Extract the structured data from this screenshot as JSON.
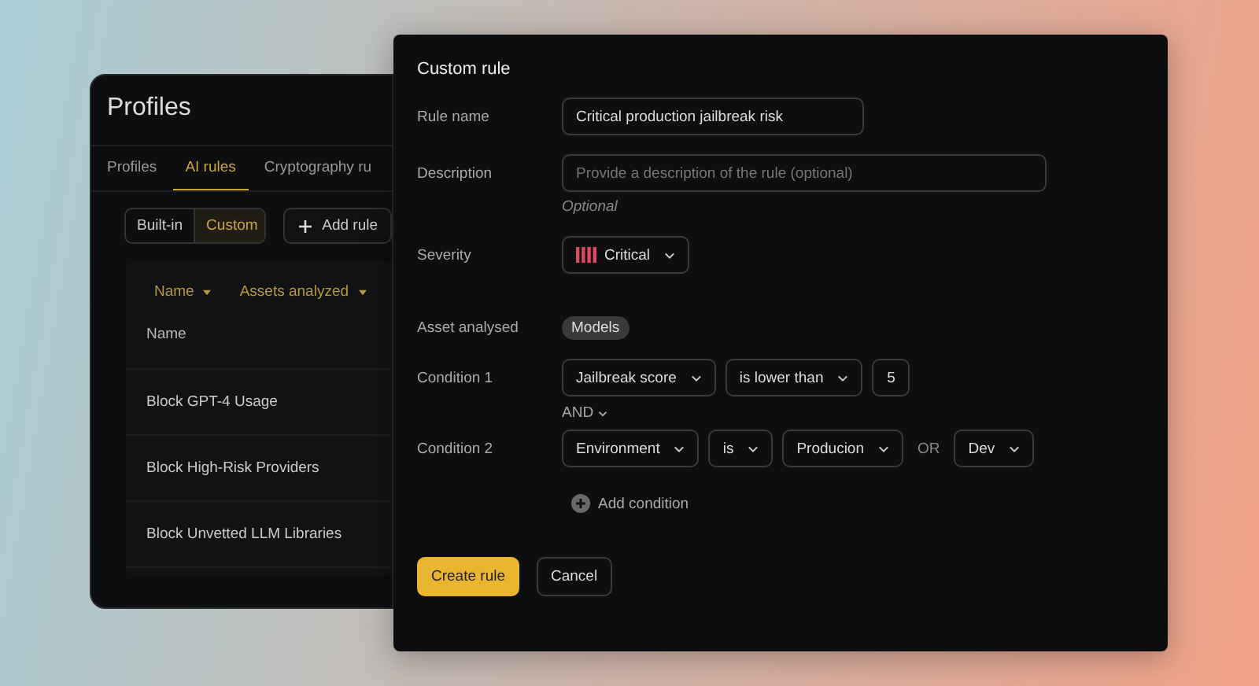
{
  "back_window": {
    "title": "Profiles",
    "tabs": [
      {
        "label": "Profiles",
        "selected": false
      },
      {
        "label": "AI rules",
        "selected": true
      },
      {
        "label": "Cryptography ru",
        "selected": false
      }
    ],
    "segments": [
      {
        "label": "Built-in",
        "selected": false
      },
      {
        "label": "Custom",
        "selected": true
      }
    ],
    "add_button": "Add rule",
    "sort_columns": [
      "Name",
      "Assets analyzed"
    ],
    "table": {
      "column": "Name",
      "rows": [
        "Block GPT-4 Usage",
        "Block High-Risk Providers",
        "Block Unvetted LLM Libraries"
      ]
    }
  },
  "dialog": {
    "title": "Custom rule",
    "rule_name": {
      "label": "Rule name",
      "value": "Critical production jailbreak risk"
    },
    "description": {
      "label": "Description",
      "placeholder": "Provide a description of the rule (optional)",
      "hint": "Optional"
    },
    "severity": {
      "label": "Severity",
      "value": "Critical",
      "color": "#e0485f"
    },
    "asset": {
      "label": "Asset analysed",
      "value": "Models"
    },
    "conditions": [
      {
        "label": "Condition 1",
        "parts": [
          {
            "kind": "select",
            "text": "Jailbreak score"
          },
          {
            "kind": "select",
            "text": "is lower than"
          },
          {
            "kind": "input",
            "text": "5"
          }
        ]
      },
      {
        "label": "Condition 2",
        "parts": [
          {
            "kind": "select",
            "text": "Environment"
          },
          {
            "kind": "select",
            "text": "is"
          },
          {
            "kind": "select",
            "text": "Producion"
          },
          {
            "kind": "connector",
            "text": "OR"
          },
          {
            "kind": "select",
            "text": "Dev"
          }
        ]
      }
    ],
    "joiner": "AND",
    "add_condition": "Add condition",
    "buttons": [
      {
        "label": "Create rule",
        "kind": "primary"
      },
      {
        "label": "Cancel",
        "kind": "secondary"
      }
    ]
  }
}
